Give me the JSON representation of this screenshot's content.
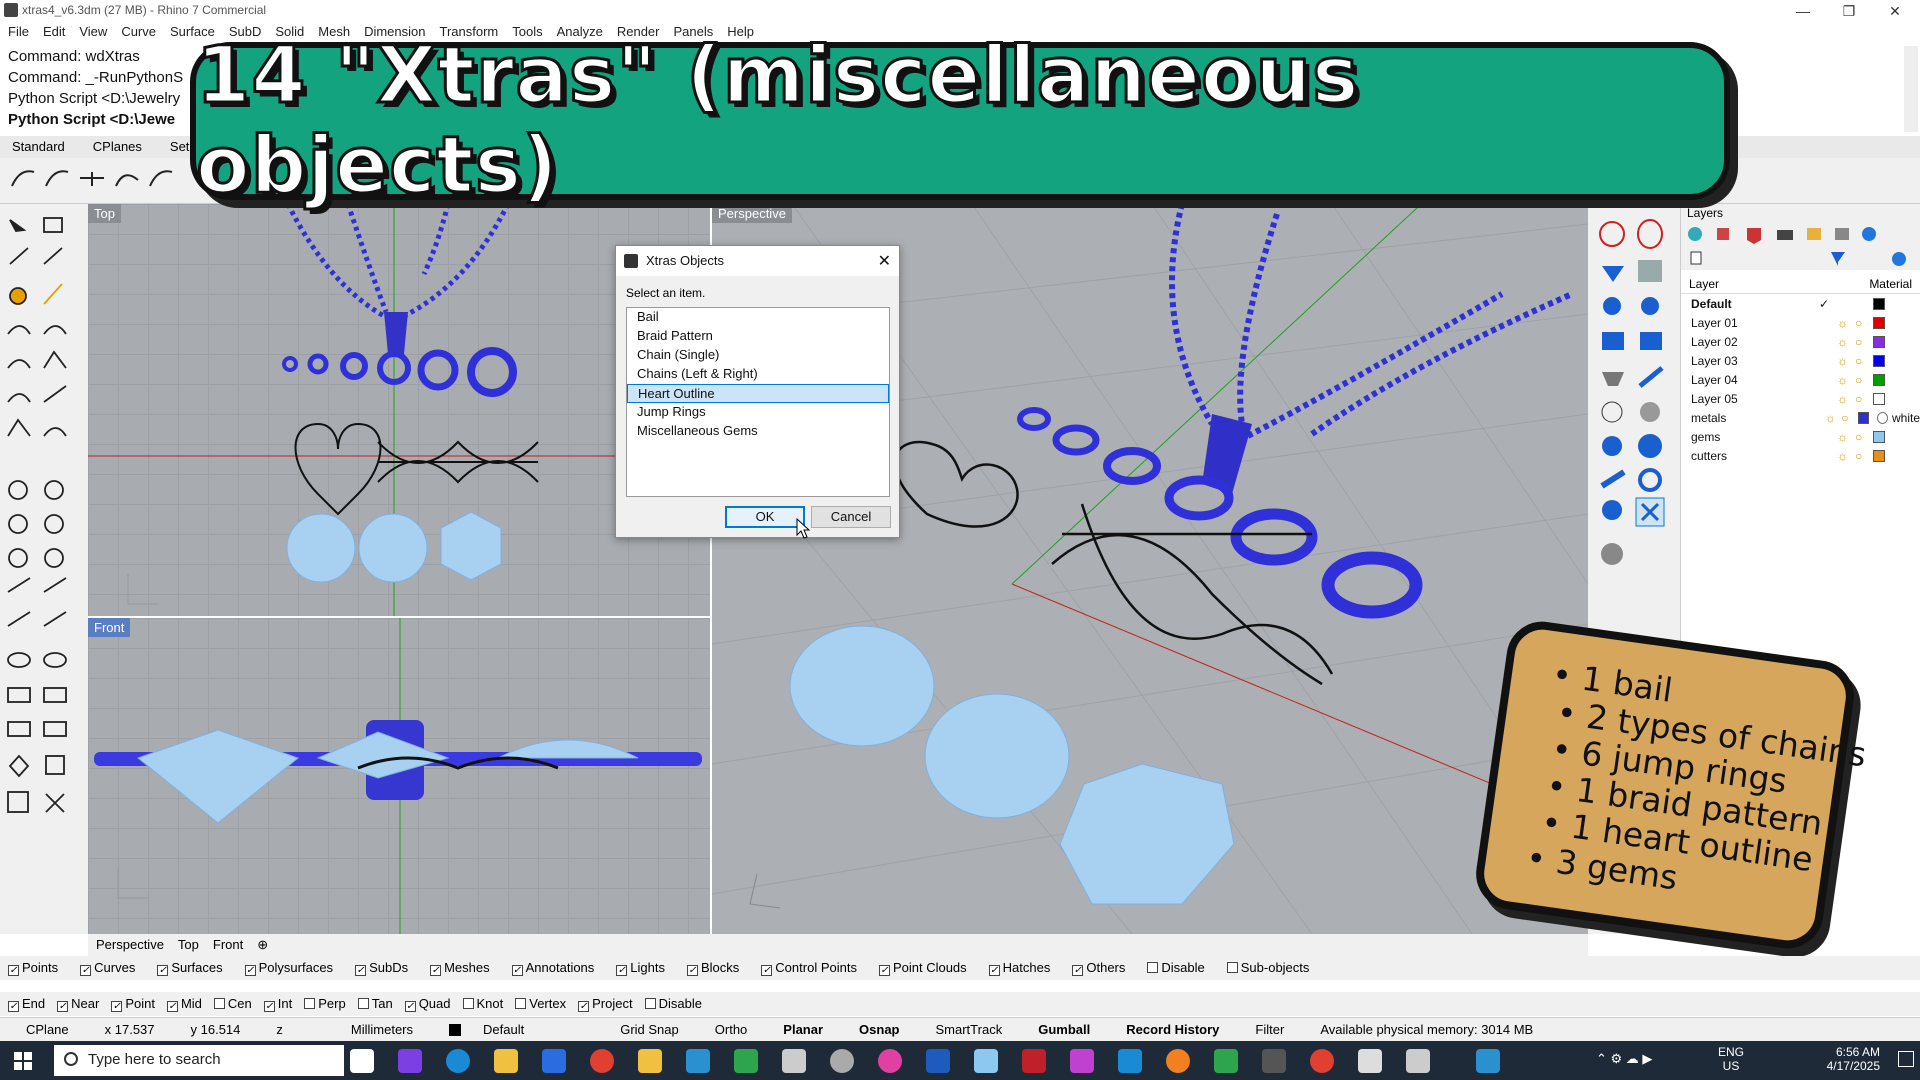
{
  "window": {
    "title": "xtras4_v6.3dm (27 MB) - Rhino 7 Commercial"
  },
  "menu": [
    "File",
    "Edit",
    "View",
    "Curve",
    "Surface",
    "SubD",
    "Solid",
    "Mesh",
    "Dimension",
    "Transform",
    "Tools",
    "Analyze",
    "Render",
    "Panels",
    "Help"
  ],
  "command_history": [
    "Command: wdXtras",
    "Command: _-RunPythonS",
    "Python Script <D:\\Jewelry"
  ],
  "command_prompt": "Python Script <D:\\Jewe",
  "toolbar_tabs": [
    "Standard",
    "CPlanes",
    "Set Vie"
  ],
  "banner": {
    "text": "14 \"Xtras\" (miscellaneous objects)"
  },
  "viewports": {
    "top": "Top",
    "front": "Front",
    "perspective": "Perspective"
  },
  "viewport_tabs": [
    "Perspective",
    "Top",
    "Front"
  ],
  "dialog": {
    "title": "Xtras Objects",
    "prompt": "Select an item.",
    "items": [
      "Bail",
      "Braid Pattern",
      "Chain (Single)",
      "Chains (Left & Right)",
      "Heart Outline",
      "Jump Rings",
      "Miscellaneous Gems"
    ],
    "selected_index": 4,
    "ok": "OK",
    "cancel": "Cancel"
  },
  "layers_panel": {
    "title": "Layers",
    "col_layer": "Layer",
    "col_material": "Material",
    "rows": [
      {
        "name": "Default",
        "color": "#000000",
        "current": true
      },
      {
        "name": "Layer 01",
        "color": "#e00000"
      },
      {
        "name": "Layer 02",
        "color": "#8b2be2"
      },
      {
        "name": "Layer 03",
        "color": "#0000ee"
      },
      {
        "name": "Layer 04",
        "color": "#00a000"
      },
      {
        "name": "Layer 05",
        "color": "#ffffff"
      },
      {
        "name": "metals",
        "color": "#3030d0",
        "material": "white"
      },
      {
        "name": "gems",
        "color": "#8ec8f0"
      },
      {
        "name": "cutters",
        "color": "#e89010"
      }
    ]
  },
  "note": {
    "items": [
      "1 bail",
      "2 types of chains",
      "6 jump rings",
      "1 braid pattern",
      "1 heart outline",
      "3 gems"
    ]
  },
  "filter_bar": [
    {
      "label": "Points",
      "checked": true
    },
    {
      "label": "Curves",
      "checked": true
    },
    {
      "label": "Surfaces",
      "checked": true
    },
    {
      "label": "Polysurfaces",
      "checked": true
    },
    {
      "label": "SubDs",
      "checked": true
    },
    {
      "label": "Meshes",
      "checked": true
    },
    {
      "label": "Annotations",
      "checked": true
    },
    {
      "label": "Lights",
      "checked": true
    },
    {
      "label": "Blocks",
      "checked": true
    },
    {
      "label": "Control Points",
      "checked": true
    },
    {
      "label": "Point Clouds",
      "checked": true
    },
    {
      "label": "Hatches",
      "checked": true
    },
    {
      "label": "Others",
      "checked": true
    },
    {
      "label": "Disable",
      "checked": false
    },
    {
      "label": "Sub-objects",
      "checked": false
    }
  ],
  "osnap_bar": [
    {
      "label": "End",
      "checked": true
    },
    {
      "label": "Near",
      "checked": true
    },
    {
      "label": "Point",
      "checked": true
    },
    {
      "label": "Mid",
      "checked": true
    },
    {
      "label": "Cen",
      "checked": false
    },
    {
      "label": "Int",
      "checked": true
    },
    {
      "label": "Perp",
      "checked": false
    },
    {
      "label": "Tan",
      "checked": false
    },
    {
      "label": "Quad",
      "checked": true
    },
    {
      "label": "Knot",
      "checked": false
    },
    {
      "label": "Vertex",
      "checked": false
    },
    {
      "label": "Project",
      "checked": true
    },
    {
      "label": "Disable",
      "checked": false
    }
  ],
  "status": {
    "cplane": "CPlane",
    "x": "x 17.537",
    "y": "y 16.514",
    "z": "z",
    "units": "Millimeters",
    "layer": "Default",
    "grid_snap": "Grid Snap",
    "ortho": "Ortho",
    "planar": "Planar",
    "osnap": "Osnap",
    "smarttrack": "SmartTrack",
    "gumball": "Gumball",
    "record_history": "Record History",
    "filter": "Filter",
    "memory": "Available physical memory: 3014 MB"
  },
  "taskbar": {
    "search_placeholder": "Type here to search",
    "time": "6:56 AM",
    "date": "4/17/2025",
    "lang": "ENG",
    "region": "US"
  }
}
